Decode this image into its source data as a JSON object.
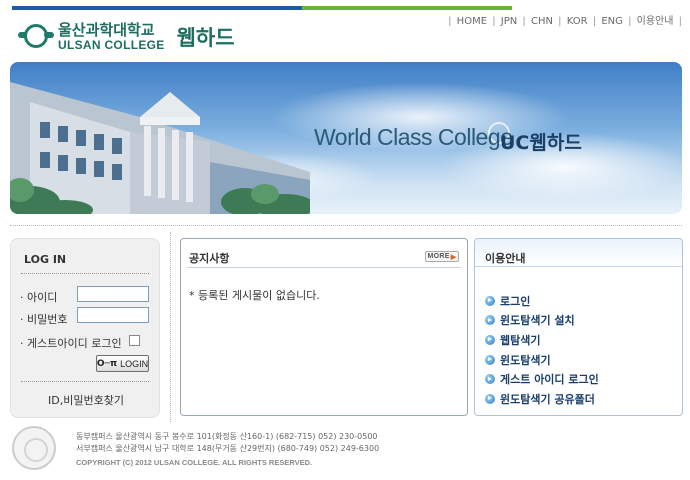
{
  "header": {
    "logo_korean": "울산과학대학교",
    "logo_english": "ULSAN COLLEGE",
    "service_name": "웹하드",
    "nav": [
      "HOME",
      "JPN",
      "CHN",
      "KOR",
      "ENG",
      "이용안내"
    ]
  },
  "banner": {
    "title": "World Class College",
    "subtitle": "UC웹하드"
  },
  "login": {
    "heading": "LOG IN",
    "id_label": "· 아이디",
    "password_label": "· 비밀번호",
    "guest_label": "· 게스트아이디 로그인",
    "login_button": "LOGIN",
    "find_link": "ID,비밀번호찾기",
    "id_value": "",
    "password_value": ""
  },
  "notice": {
    "heading": "공지사항",
    "more_label": "MORE",
    "empty_message": "* 등록된 게시물이 없습니다."
  },
  "guide": {
    "heading": "이용안내",
    "items": [
      "로그인",
      "윈도탐색기 설치",
      "웹탐색기",
      "윈도탐색기",
      "게스트 아이디 로그인",
      "윈도탐색기 공유폴더"
    ]
  },
  "footer": {
    "east_campus": "동부캠퍼스  울산광역시 동구 봉수로 101(화정동 산160-1) (682-715)  052) 230-0500",
    "west_campus": "서부캠퍼스  울산광역시 남구 대학로 148(무거동 산29번지) (680-749)  052) 249-6300",
    "copyright": "COPYRIGHT (C) 2012 ULSAN COLLEGE.  ALL RIGHTS RESERVED."
  },
  "colors": {
    "brand_green": "#1e6e62",
    "top_blue": "#1d5aa8",
    "top_green": "#6bb43a",
    "link_navy": "#1a3e6c"
  }
}
